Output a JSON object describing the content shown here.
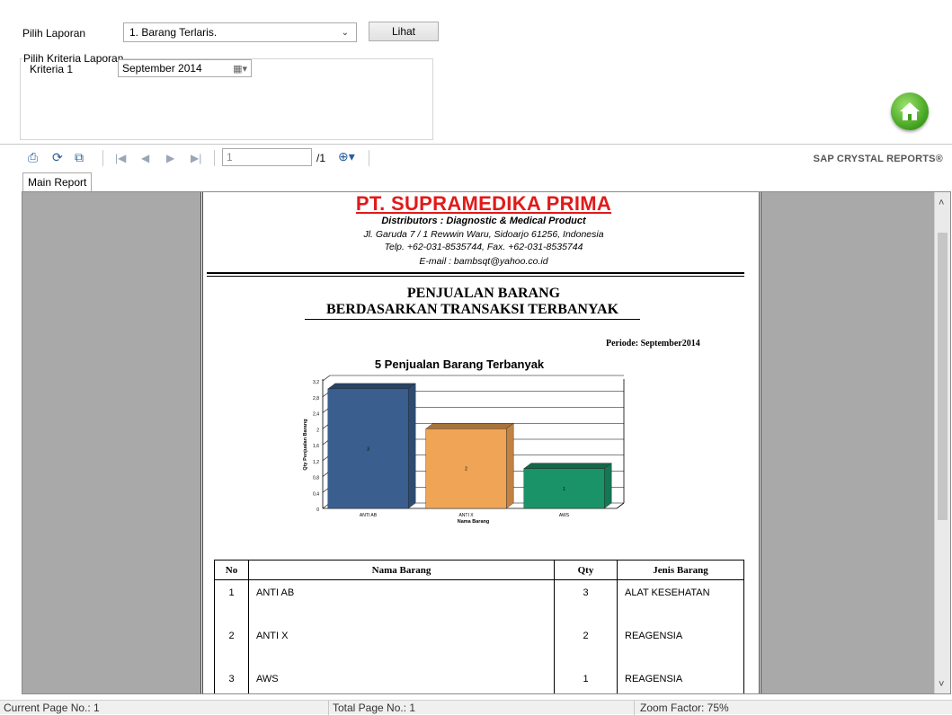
{
  "form": {
    "pilih_laporan_label": "Pilih Laporan",
    "pilih_laporan_value": "1. Barang Terlaris.",
    "lihat_button": "Lihat",
    "group_legend": "Pilih Kriteria Laporan",
    "kriteria_label": "Kriteria 1",
    "kriteria_value": "September 2014"
  },
  "toolbar": {
    "page_input": "1",
    "page_total": "/1",
    "brand": "SAP CRYSTAL REPORTS®",
    "tab_main": "Main Report"
  },
  "report": {
    "company": "PT. SUPRAMEDIKA PRIMA",
    "distributor": "Distributors : Diagnostic & Medical Product",
    "address": "Jl. Garuda 7 / 1 Rewwin Waru, Sidoarjo 61256, Indonesia",
    "phone": "Telp. +62-031-8535744, Fax. +62-031-8535744",
    "email": "E-mail : bambsqt@yahoo.co.id",
    "title_line1": "PENJUALAN BARANG",
    "title_line2": "BERDASARKAN TRANSAKSI TERBANYAK",
    "periode": "Periode:  September2014",
    "table_headers": [
      "No",
      "Nama Barang",
      "Qty",
      "Jenis Barang"
    ],
    "rows": [
      {
        "no": "1",
        "nama": "ANTI AB",
        "qty": "3",
        "jenis": "ALAT KESEHATAN"
      },
      {
        "no": "2",
        "nama": "ANTI X",
        "qty": "2",
        "jenis": "REAGENSIA"
      },
      {
        "no": "3",
        "nama": "AWS",
        "qty": "1",
        "jenis": "REAGENSIA"
      }
    ]
  },
  "chart_data": {
    "type": "bar",
    "title": "5 Penjualan Barang Terbanyak",
    "xlabel": "Nama Barang",
    "ylabel": "Qty Penjualan Barang",
    "categories": [
      "ANTI AB",
      "ANTI X",
      "AWS"
    ],
    "values": [
      3,
      2,
      1
    ],
    "ylim": [
      0,
      3.2
    ],
    "yticks": [
      "0",
      "0,4",
      "0,8",
      "1,2",
      "1,6",
      "2",
      "2,4",
      "2,8",
      "3,2"
    ],
    "colors": [
      "#3a5f8f",
      "#f0a455",
      "#1a9368"
    ],
    "grid": true
  },
  "status": {
    "current_page": "Current Page No.: 1",
    "total_page": "Total Page No.: 1",
    "zoom": "Zoom Factor: 75%"
  }
}
